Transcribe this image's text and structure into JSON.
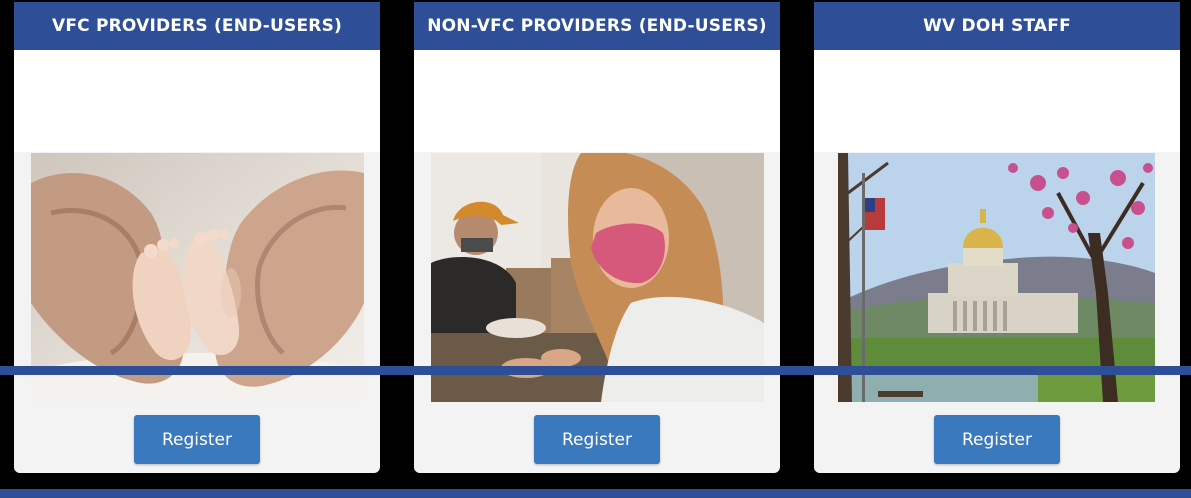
{
  "cards": [
    {
      "title": "VFC PROVIDERS (END-USERS)",
      "image": "baby-feet-in-hands-photo",
      "button_label": "Register"
    },
    {
      "title": "NON-VFC PROVIDERS (END-USERS)",
      "image": "masked-woman-cafe-photo",
      "button_label": "Register"
    },
    {
      "title": "WV DOH STAFF",
      "image": "wv-capitol-building-photo",
      "button_label": "Register"
    }
  ],
  "colors": {
    "header": "#2e4e97",
    "button": "#3a79bd",
    "card_bg": "#f3f3f3",
    "page_bg": "#000000",
    "divider": "#2e4e97"
  }
}
